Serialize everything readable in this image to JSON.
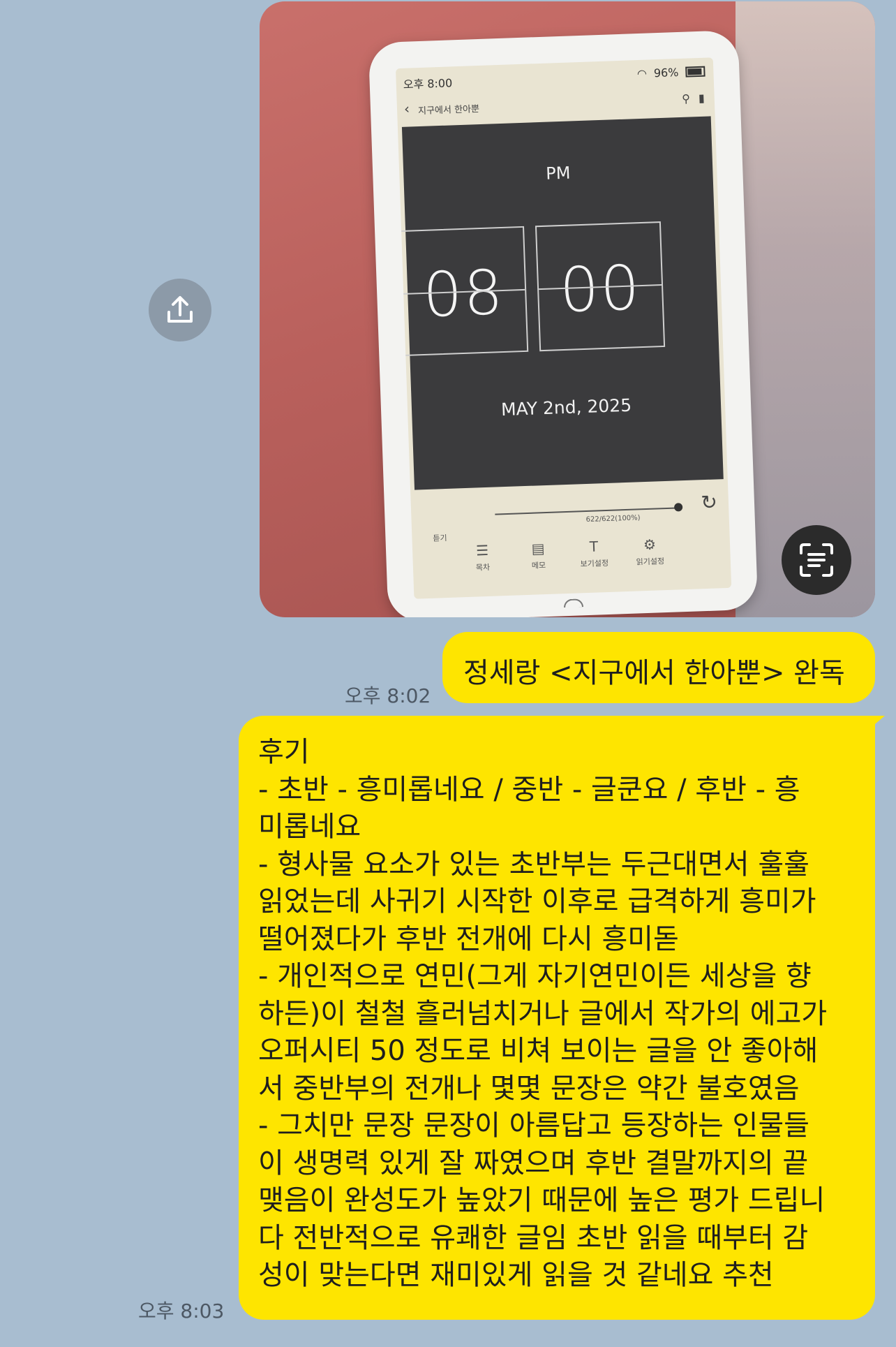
{
  "attached_photo": {
    "device_screen": {
      "status_time": "오후 8:00",
      "battery": "96%",
      "book_title": "지구에서 한아뿐",
      "clock": {
        "ampm": "PM",
        "hour": "08",
        "minute": "00",
        "date": "MAY 2nd, 2025"
      },
      "progress_label": "622/622(100%)",
      "bottom_bar": [
        "목차",
        "메모",
        "보기설정",
        "읽기설정"
      ],
      "left_label": "듣기"
    }
  },
  "messages": [
    {
      "text": "정세랑 <지구에서 한아뿐> 완독",
      "time": "오후 8:02"
    },
    {
      "text": "후기\n- 초반 - 흥미롭네요 / 중반 - 글쿤요 / 후반 - 흥\n미롭네요\n- 형사물 요소가 있는 초반부는 두근대면서 훌훌\n읽었는데 사귀기 시작한 이후로 급격하게 흥미가\n떨어졌다가 후반 전개에 다시 흥미돋\n- 개인적으로 연민(그게 자기연민이든 세상을 향\n하든)이 철철 흘러넘치거나 글에서 작가의 에고가\n오퍼시티 50 정도로 비쳐 보이는 글을 안 좋아해\n서 중반부의 전개나 몇몇 문장은 약간 불호였음\n- 그치만 문장 문장이 아름답고 등장하는 인물들\n이 생명력 있게 잘 짜였으며 후반 결말까지의 끝\n맺음이 완성도가 높았기 때문에 높은 평가 드립니\n다 전반적으로 유쾌한 글임 초반 읽을 때부터 감\n성이 맞는다면 재미있게 읽을 것 같네요 추천",
      "time": "오후 8:03"
    }
  ],
  "icons": {
    "share": "share-icon",
    "scan": "text-scan-icon"
  },
  "colors": {
    "background": "#a8bdd0",
    "bubble": "#fee500"
  }
}
